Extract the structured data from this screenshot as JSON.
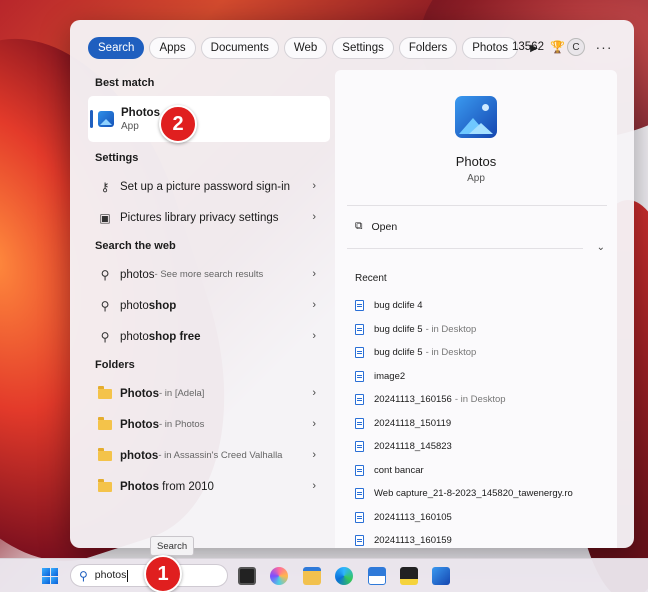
{
  "filters": [
    "Search",
    "Apps",
    "Documents",
    "Web",
    "Settings",
    "Folders",
    "Photos"
  ],
  "header": {
    "points": "13562",
    "avatar_initial": "C"
  },
  "left": {
    "best_match_title": "Best match",
    "best": {
      "name": "Photos",
      "type": "App"
    },
    "settings_title": "Settings",
    "settings_items": [
      "Set up a picture password sign-in",
      "Pictures library privacy settings"
    ],
    "web_title": "Search the web",
    "web_items": [
      {
        "text": "photos",
        "bold": "",
        "suffix": " - See more search results"
      },
      {
        "text": "photo",
        "bold": "shop",
        "suffix": ""
      },
      {
        "text": "photo",
        "bold": "shop free",
        "suffix": ""
      }
    ],
    "folders_title": "Folders",
    "folders": [
      {
        "name": "Photos",
        "loc": " - in [Adela]"
      },
      {
        "name": "Photos",
        "loc": " - in Photos"
      },
      {
        "name": "photos",
        "loc": " - in Assassin's Creed Valhalla"
      },
      {
        "name": "Photos",
        "loc": "",
        "extra": " from 2010"
      }
    ]
  },
  "right": {
    "app_name": "Photos",
    "app_type": "App",
    "open_label": "Open",
    "recent_title": "Recent",
    "recent": [
      {
        "name": "bug dclife 4",
        "loc": ""
      },
      {
        "name": "bug dclife 5",
        "loc": "- in Desktop"
      },
      {
        "name": "bug dclife 5",
        "loc": "- in Desktop"
      },
      {
        "name": "image2",
        "loc": ""
      },
      {
        "name": "20241113_160156",
        "loc": "- in Desktop"
      },
      {
        "name": "20241118_150119",
        "loc": ""
      },
      {
        "name": "20241118_145823",
        "loc": ""
      },
      {
        "name": "cont bancar",
        "loc": ""
      },
      {
        "name": "Web capture_21-8-2023_145820_tawenergy.ro",
        "loc": ""
      },
      {
        "name": "20241113_160105",
        "loc": ""
      },
      {
        "name": "20241113_160159",
        "loc": ""
      }
    ]
  },
  "taskbar": {
    "search_value": "photos",
    "tooltip": "Search"
  },
  "badges": {
    "step1": "1",
    "step2": "2"
  }
}
